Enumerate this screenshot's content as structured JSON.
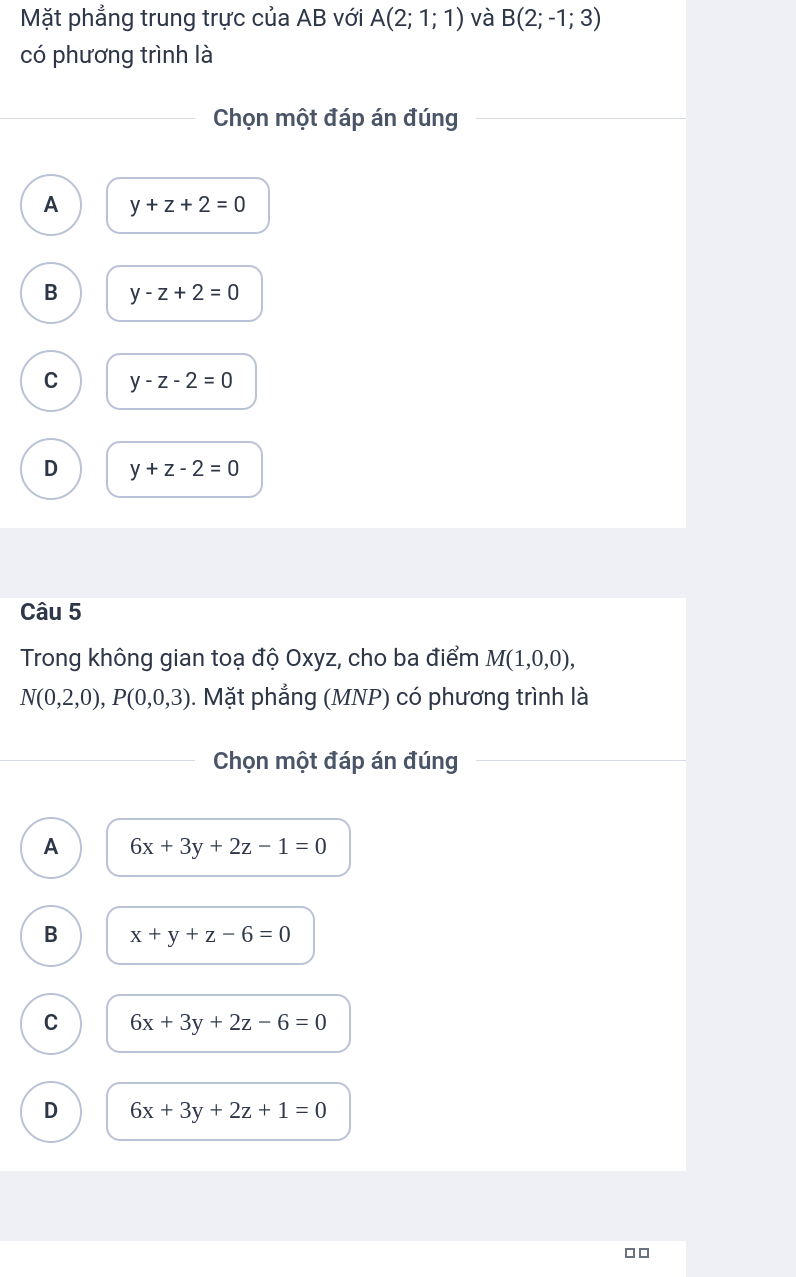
{
  "q4": {
    "text_line1": "Mặt phẳng trung trực của AB với A(2; 1; 1) và B(2; -1; 3)",
    "text_line2": "có phương trình là",
    "instruction": "Chọn một đáp án đúng",
    "options": [
      {
        "letter": "A",
        "label": "y + z + 2 = 0"
      },
      {
        "letter": "B",
        "label": "y - z + 2 = 0"
      },
      {
        "letter": "C",
        "label": "y - z - 2 = 0"
      },
      {
        "letter": "D",
        "label": "y + z - 2 = 0"
      }
    ]
  },
  "q5": {
    "title": "Câu 5",
    "text_part1": "Trong không gian toạ độ Oxyz, cho ba điểm ",
    "text_M": "M(1,0,0),",
    "text_N": "N(0,2,0), ",
    "text_P": "P(0,0,3)",
    "text_part2": ". Mặt phẳng ",
    "text_MNP": "(MNP)",
    "text_part3": " có phương trình là",
    "instruction": "Chọn một đáp án đúng",
    "options": [
      {
        "letter": "A",
        "label": "6x + 3y + 2z − 1 = 0"
      },
      {
        "letter": "B",
        "label": "x + y + z − 6 = 0"
      },
      {
        "letter": "C",
        "label": "6x + 3y + 2z − 6 = 0"
      },
      {
        "letter": "D",
        "label": "6x + 3y + 2z + 1 = 0"
      }
    ]
  }
}
